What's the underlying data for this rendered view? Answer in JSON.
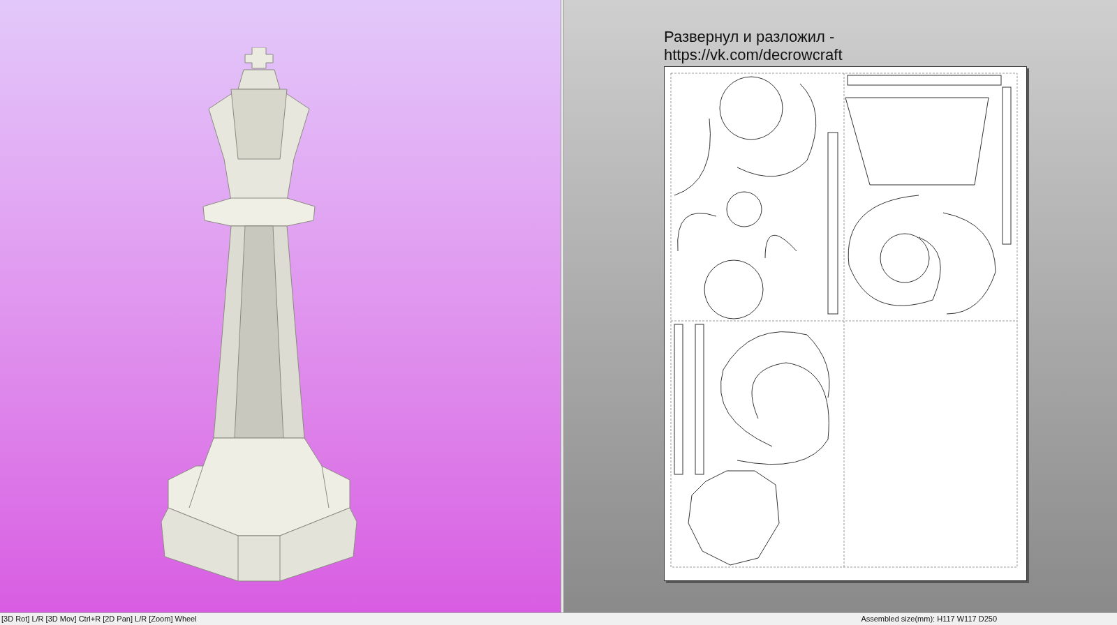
{
  "view_2d": {
    "note_lines": [
      "Развернул и разложил -",
      "https://vk.com/decrowcraft"
    ]
  },
  "status_bar": {
    "controls_hint": "[3D Rot] L/R [3D Mov] Ctrl+R [2D Pan] L/R [Zoom] Wheel",
    "assembled_size": "Assembled size(mm): H117 W117 D250"
  }
}
